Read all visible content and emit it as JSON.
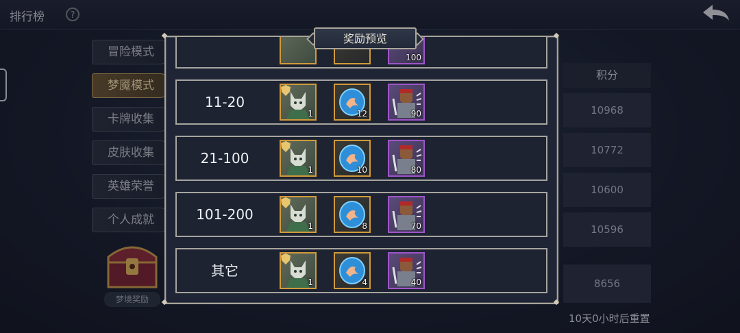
{
  "screen": {
    "title": "排行榜"
  },
  "side_menu": [
    {
      "label": "冒险模式",
      "active": false
    },
    {
      "label": "梦魇模式",
      "active": true
    },
    {
      "label": "卡牌收集",
      "active": false
    },
    {
      "label": "皮肤收集",
      "active": false
    },
    {
      "label": "英雄荣誉",
      "active": false
    },
    {
      "label": "个人成就",
      "active": false
    }
  ],
  "chest": {
    "label": "梦境奖励"
  },
  "rank_table": {
    "score_header": "积分",
    "scores": [
      "10968",
      "10772",
      "10600",
      "10596"
    ],
    "my_score": "8656",
    "reset_text": "10天0小时后重置"
  },
  "modal": {
    "title": "奖励预览",
    "partial_top_row": {
      "monster_count": "100"
    },
    "rows": [
      {
        "rank": "11-20",
        "hero_count": "1",
        "gem_count": "12",
        "monster_count": "90"
      },
      {
        "rank": "21-100",
        "hero_count": "1",
        "gem_count": "10",
        "monster_count": "80"
      },
      {
        "rank": "101-200",
        "hero_count": "1",
        "gem_count": "8",
        "monster_count": "70"
      },
      {
        "rank": "其它",
        "hero_count": "1",
        "gem_count": "4",
        "monster_count": "40"
      }
    ]
  },
  "icons": {
    "help": "help-gear-icon",
    "back": "back-arrow-icon",
    "chest": "treasure-chest-icon",
    "hero": "wolf-hero-card-icon",
    "gem": "blue-crystal-icon",
    "monster": "goblin-warrior-card-icon"
  },
  "colors": {
    "gold_frame": "#d29a3a",
    "purple_frame": "#9e55c8",
    "modal_border": "#a9a59a"
  }
}
